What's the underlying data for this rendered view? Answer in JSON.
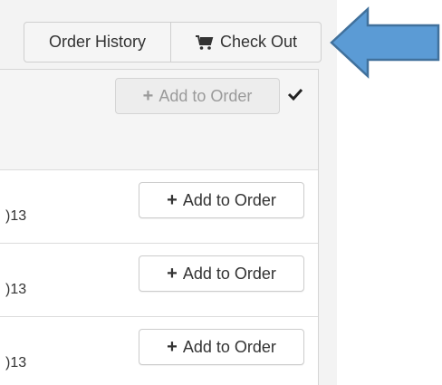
{
  "header": {
    "order_history_label": "Order History",
    "check_out_label": "Check Out",
    "cart_icon": "shopping-cart-icon"
  },
  "rows": [
    {
      "add_label": "Add to Order",
      "date_fragment": "",
      "state": "disabled",
      "checked": true
    },
    {
      "add_label": "Add to Order",
      "date_fragment": ")13",
      "state": "enabled",
      "checked": false
    },
    {
      "add_label": "Add to Order",
      "date_fragment": ")13",
      "state": "enabled",
      "checked": false
    },
    {
      "add_label": "Add to Order",
      "date_fragment": ")13",
      "state": "enabled",
      "checked": false
    }
  ],
  "annotation": {
    "arrow_color": "#5b9bd5",
    "arrow_border": "#41719c",
    "direction": "left"
  },
  "colors": {
    "panel_background": "#f3f3f3",
    "button_background": "#f5f5f5",
    "text": "#333333"
  }
}
